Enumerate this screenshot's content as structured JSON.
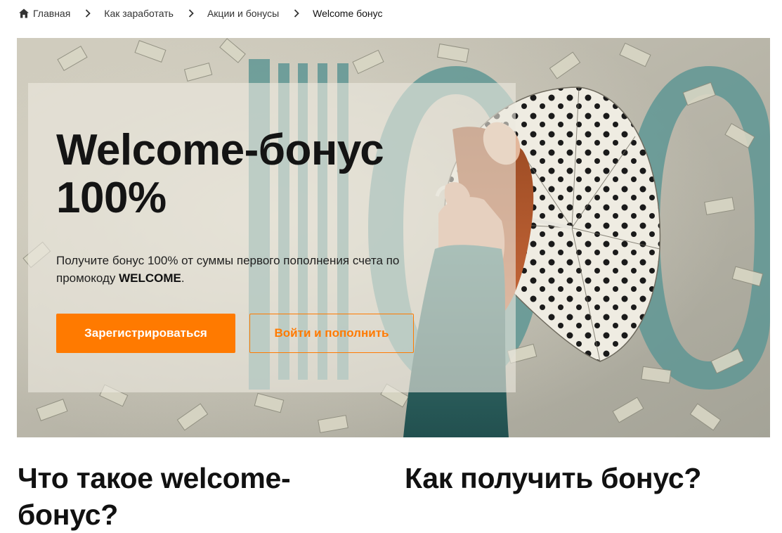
{
  "breadcrumb": {
    "items": [
      {
        "label": "Главная",
        "icon": "home-icon"
      },
      {
        "label": "Как заработать"
      },
      {
        "label": "Акции и бонусы"
      },
      {
        "label": "Welcome бонус"
      }
    ]
  },
  "hero": {
    "title_line1": "Welcome-бонус",
    "title_line2": "100%",
    "description_text": "Получите бонус 100% от суммы первого пополнения счета по промокоду ",
    "promo_code": "WELCOME",
    "description_end": ".",
    "primary_button": "Зарегистрироваться",
    "secondary_button": "Войти и пополнить",
    "image": "woman-with-polka-dot-umbrella-under-falling-money"
  },
  "sections": {
    "left_heading": "Что такое welcome-бонус?",
    "right_heading": "Как получить бонус?"
  },
  "colors": {
    "accent": "#ff7a00",
    "text": "#141414"
  }
}
